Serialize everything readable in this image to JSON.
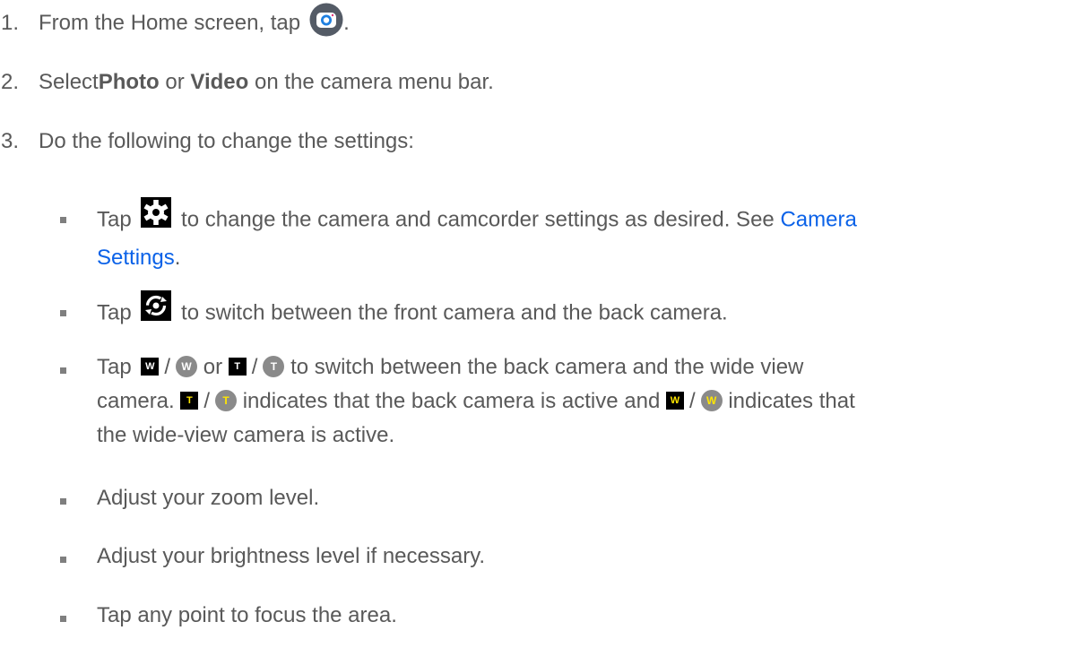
{
  "steps": [
    {
      "num": "1.",
      "text": "From the Home screen, tap",
      "tail": ".",
      "icon": "camera-app-icon"
    },
    {
      "num": "2.",
      "pre": "Select ",
      "b1": "Photo",
      "mid": " or ",
      "b2": "Video",
      "post": " on the camera menu bar."
    },
    {
      "num": "3.",
      "text": "Do the following to change the settings:"
    }
  ],
  "bullets": [
    {
      "pre": "Tap",
      "icon": "settings-gear-icon",
      "text1": "to change the camera and camcorder settings as desired. See ",
      "link1": "Camera",
      "link2": "Settings",
      "end": "."
    },
    {
      "pre": "Tap",
      "icon": "switch-camera-icon",
      "text": "to switch between the front camera and the back camera."
    },
    {
      "pre": "Tap",
      "w_label": "W",
      "t_label": "T",
      "slash": "/",
      "or": "or",
      "l1_end": "to switch between the back camera and the wide view",
      "l2_start": "camera.",
      "l2_mid": "indicates that the back camera is active and",
      "l2_end": "indicates that",
      "l3": "the wide-view camera is active."
    },
    {
      "text": "Adjust your zoom level."
    },
    {
      "text": "Adjust your brightness level if necessary."
    },
    {
      "text": "Tap any point to focus the area."
    }
  ],
  "colors": {
    "text": "#595959",
    "link": "#0b62e8",
    "bullet": "#7f7f7f",
    "highlight": "#ffe600"
  }
}
